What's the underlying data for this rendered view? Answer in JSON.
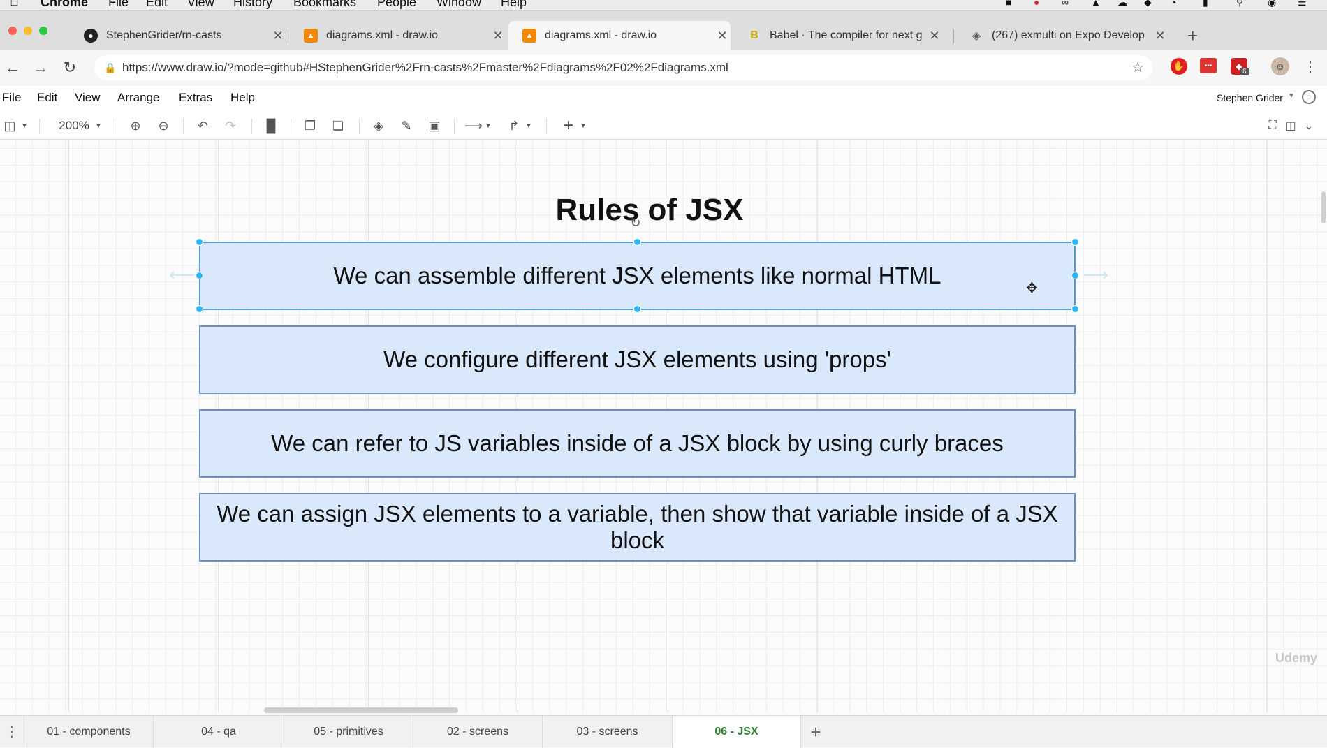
{
  "macmenu": {
    "app": "Chrome",
    "items": [
      "File",
      "Edit",
      "View",
      "History",
      "Bookmarks",
      "People",
      "Window",
      "Help"
    ]
  },
  "tabs": [
    {
      "label": "StephenGrider/rn-casts",
      "icon": "github-icon"
    },
    {
      "label": "diagrams.xml - draw.io",
      "icon": "drawio-icon"
    },
    {
      "label": "diagrams.xml - draw.io",
      "icon": "drawio-icon",
      "active": true
    },
    {
      "label": "Babel · The compiler for next g",
      "icon": "babel-icon"
    },
    {
      "label": "(267) exmulti on Expo Develop",
      "icon": "expo-icon"
    }
  ],
  "address": {
    "url": "https://www.draw.io/?mode=github#HStephenGrider%2Frn-casts%2Fmaster%2Fdiagrams%2F02%2Fdiagrams.xml",
    "badge": "6"
  },
  "appmenu": {
    "items": [
      "File",
      "Edit",
      "View",
      "Arrange",
      "Extras",
      "Help"
    ],
    "user": "Stephen Grider"
  },
  "toolbar": {
    "zoom": "200%"
  },
  "diagram": {
    "title": "Rules of JSX",
    "boxes": [
      "We can assemble different JSX elements like normal HTML",
      "We configure different JSX elements using 'props'",
      "We can refer to JS variables inside of a JSX block by using curly braces",
      "We can assign JSX elements to a variable, then show that variable inside of a JSX block"
    ],
    "fill_color": "#dae8fc",
    "stroke_color": "#6c8ebf",
    "selection_color": "#29b6f2"
  },
  "watermark": "Udemy",
  "pages": {
    "items": [
      "01 - components",
      "04 - qa",
      "05 - primitives",
      "02 - screens",
      "03 - screens",
      "06 - JSX"
    ],
    "active": "06 - JSX"
  }
}
